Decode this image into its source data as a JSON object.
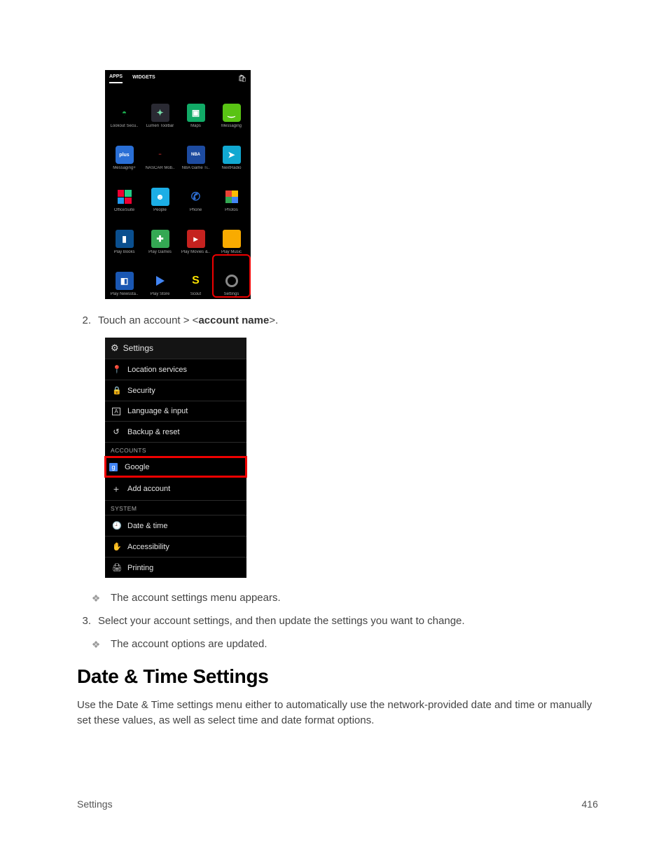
{
  "phone1": {
    "tabs": {
      "apps": "APPS",
      "widgets": "WIDGETS"
    },
    "apps": [
      {
        "name": "Lookout Secu..",
        "cls": "ic-lookout",
        "glyph": "◓"
      },
      {
        "name": "Lumen Toolbar",
        "cls": "ic-lumen",
        "glyph": "✦"
      },
      {
        "name": "Maps",
        "cls": "ic-maps",
        "glyph": "▣"
      },
      {
        "name": "Messaging",
        "cls": "ic-msg",
        "glyph": "‿"
      },
      {
        "name": "Messaging+",
        "cls": "ic-msgplus",
        "glyph": "plus"
      },
      {
        "name": "NASCAR Mob..",
        "cls": "ic-nascar",
        "glyph": "═"
      },
      {
        "name": "NBA Game Ti..",
        "cls": "ic-nba",
        "glyph": "NBA"
      },
      {
        "name": "NextRadio",
        "cls": "ic-nextradio",
        "glyph": "➤"
      },
      {
        "name": "OfficeSuite",
        "cls": "ic-office",
        "glyph": ""
      },
      {
        "name": "People",
        "cls": "ic-people",
        "glyph": "☻"
      },
      {
        "name": "Phone",
        "cls": "ic-phone",
        "glyph": "✆"
      },
      {
        "name": "Photos",
        "cls": "ic-photos",
        "glyph": ""
      },
      {
        "name": "Play Books",
        "cls": "ic-pbooks",
        "glyph": "▮"
      },
      {
        "name": "Play Games",
        "cls": "ic-pgames",
        "glyph": "✚"
      },
      {
        "name": "Play Movies &..",
        "cls": "ic-pmovies",
        "glyph": "▸"
      },
      {
        "name": "Play Music",
        "cls": "ic-pmusic",
        "glyph": ""
      },
      {
        "name": "Play Newssta..",
        "cls": "ic-pnews",
        "glyph": "◧"
      },
      {
        "name": "Play Store",
        "cls": "ic-pstore",
        "glyph": ""
      },
      {
        "name": "Scout",
        "cls": "ic-scout",
        "glyph": "S"
      },
      {
        "name": "Settings",
        "cls": "ic-settings",
        "glyph": "",
        "outlined": true
      }
    ]
  },
  "step2": {
    "num": "2.",
    "text_a": "Touch an account > <",
    "bold": "account name",
    "text_b": ">."
  },
  "settings": {
    "header": "Settings",
    "items": [
      {
        "icon": "📍",
        "label": "Location services",
        "iname": "location-icon"
      },
      {
        "icon": "🔒",
        "label": "Security",
        "iname": "lock-icon"
      },
      {
        "icon": "A",
        "label": "Language & input",
        "iname": "language-icon",
        "box": true
      },
      {
        "icon": "↺",
        "label": "Backup & reset",
        "iname": "reset-icon"
      }
    ],
    "sec_accounts": "ACCOUNTS",
    "google": {
      "icon": "g",
      "label": "Google"
    },
    "add": {
      "icon": "+",
      "label": "Add account"
    },
    "sec_system": "SYSTEM",
    "sys": [
      {
        "icon": "🕘",
        "label": "Date & time",
        "iname": "clock-icon"
      },
      {
        "icon": "✋",
        "label": "Accessibility",
        "iname": "hand-icon"
      },
      {
        "icon": "🖨",
        "label": "Printing",
        "iname": "printer-icon"
      }
    ]
  },
  "bullet1": "The account settings menu appears.",
  "step3": {
    "num": "3.",
    "text": "Select your account settings, and then update the settings you want to change."
  },
  "bullet2": "The account options are updated.",
  "heading": "Date & Time Settings",
  "para": "Use the Date & Time settings menu either to automatically use the network-provided date and time or manually set these values, as well as select time and date format options.",
  "footer": {
    "left": "Settings",
    "right": "416"
  }
}
